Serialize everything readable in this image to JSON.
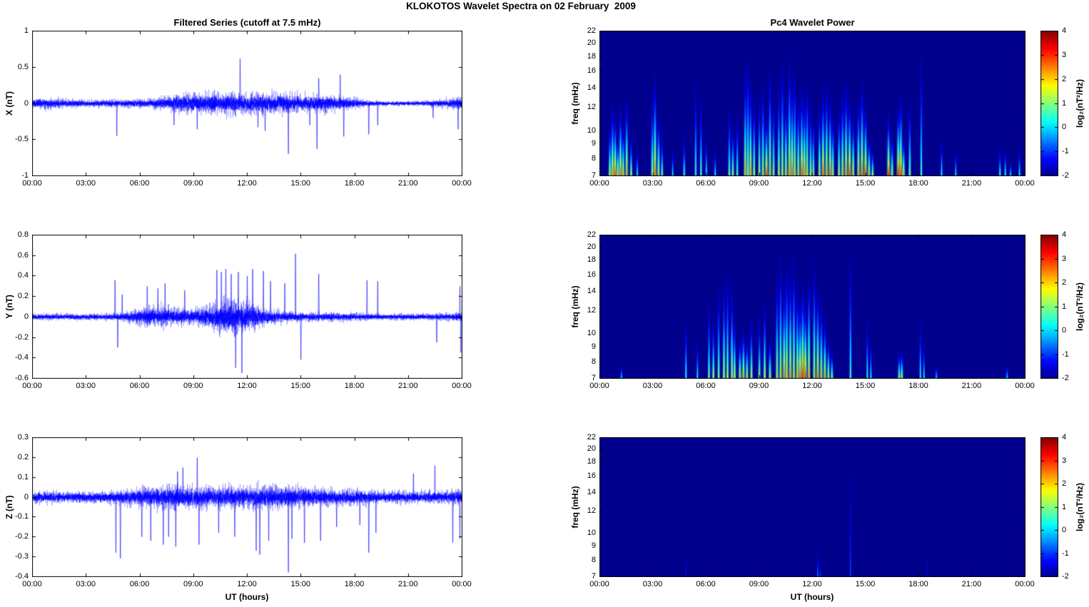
{
  "figure": {
    "title": "KLOKOTOS Wavelet Spectra on 02 February  2009"
  },
  "colors": {
    "background": "#FFFFFF",
    "axis": "#000000",
    "series_line": "#0000FF",
    "heatmap_background": "#00008C",
    "colormap": "jet"
  },
  "chart_data": {
    "time_axis": {
      "xlabel": "UT (hours)",
      "range_hours": [
        0,
        24
      ],
      "tick_hours": [
        0,
        3,
        6,
        9,
        12,
        15,
        18,
        21,
        24
      ],
      "tick_labels": [
        "00:00",
        "03:00",
        "06:00",
        "09:00",
        "12:00",
        "15:00",
        "18:00",
        "21:00",
        "00:00"
      ]
    },
    "colorbar": {
      "label": "log₂(nT²/Hz)",
      "colormap": "jet",
      "clim": [
        -2,
        4
      ],
      "tick_values": [
        4,
        3,
        2,
        1,
        0,
        -1,
        -2
      ],
      "tick_labels": [
        "4",
        "3",
        "2",
        "1",
        "0",
        "-1",
        "-2"
      ]
    },
    "panels": [
      {
        "id": "x-filtered-series",
        "type": "line",
        "title": "Filtered Series (cutoff at 7.5 mHz)",
        "ylabel": "X (nT)",
        "ylim": [
          -1,
          1
        ],
        "ytick_values": [
          1,
          0.5,
          0,
          -0.5,
          -1
        ],
        "ytick_labels": [
          "1",
          "0.5",
          "0",
          "-0.5",
          "-1"
        ],
        "seed": 11,
        "noise_envelope_hourly": [
          0.11,
          0.12,
          0.09,
          0.08,
          0.08,
          0.09,
          0.1,
          0.13,
          0.19,
          0.23,
          0.24,
          0.25,
          0.24,
          0.23,
          0.24,
          0.22,
          0.19,
          0.18,
          0.12,
          0.06,
          0.05,
          0.05,
          0.06,
          0.1,
          0.13
        ],
        "spikes_time_value": [
          [
            4.7,
            -0.45
          ],
          [
            7.9,
            -0.3
          ],
          [
            9.2,
            -0.36
          ],
          [
            11.6,
            0.62
          ],
          [
            12.6,
            -0.33
          ],
          [
            13.0,
            -0.38
          ],
          [
            14.3,
            -0.7
          ],
          [
            15.5,
            -0.3
          ],
          [
            15.9,
            -0.63
          ],
          [
            16.0,
            0.35
          ],
          [
            17.2,
            0.4
          ],
          [
            17.4,
            -0.46
          ],
          [
            18.8,
            -0.43
          ],
          [
            19.3,
            -0.3
          ],
          [
            22.4,
            -0.2
          ],
          [
            23.8,
            -0.36
          ]
        ]
      },
      {
        "id": "x-wavelet-power",
        "type": "heatmap",
        "title": "Pc4 Wavelet Power",
        "ylabel": "freq (mHz)",
        "yscale": "log",
        "flim_mHz": [
          7,
          22
        ],
        "ytick_values": [
          22,
          20,
          18,
          16,
          14,
          12,
          10,
          9,
          8,
          7
        ],
        "ytick_labels": [
          "22",
          "20",
          "18",
          "16",
          "14",
          "12",
          "10",
          "9",
          "8",
          "7"
        ],
        "clim_log2_power": [
          -2,
          4
        ],
        "event_format": [
          "hour",
          "freq_top_mHz",
          "peak_log2_power_at_base"
        ],
        "events": [
          [
            0.55,
            11,
            2.0
          ],
          [
            0.7,
            13,
            2.6
          ],
          [
            0.85,
            12,
            3.0
          ],
          [
            1.0,
            10,
            2.2
          ],
          [
            1.15,
            13,
            2.8
          ],
          [
            1.3,
            11,
            2.2
          ],
          [
            1.5,
            14,
            2.5
          ],
          [
            1.75,
            10,
            1.6
          ],
          [
            2.1,
            9,
            0.6
          ],
          [
            2.95,
            14,
            1.8
          ],
          [
            3.1,
            17,
            2.7
          ],
          [
            3.3,
            12,
            2.1
          ],
          [
            3.5,
            10,
            1.3
          ],
          [
            4.1,
            9,
            0.4
          ],
          [
            4.75,
            10,
            0.9
          ],
          [
            5.4,
            16,
            0.9
          ],
          [
            5.7,
            14,
            1.0
          ],
          [
            6.0,
            10,
            0.6
          ],
          [
            6.5,
            9,
            0.5
          ],
          [
            7.3,
            13,
            1.3
          ],
          [
            7.5,
            11,
            1.6
          ],
          [
            7.75,
            12,
            1.1
          ],
          [
            8.2,
            18,
            2.2
          ],
          [
            8.35,
            20,
            1.8
          ],
          [
            8.5,
            16,
            2.4
          ],
          [
            8.7,
            14,
            1.7
          ],
          [
            9.0,
            14,
            1.8
          ],
          [
            9.2,
            16,
            2.0
          ],
          [
            9.4,
            12,
            3.0
          ],
          [
            9.6,
            18,
            2.2
          ],
          [
            9.8,
            14,
            1.6
          ],
          [
            10.1,
            16,
            1.8
          ],
          [
            10.3,
            19,
            2.0
          ],
          [
            10.5,
            14,
            2.2
          ],
          [
            10.7,
            20,
            2.4
          ],
          [
            10.85,
            16,
            2.8
          ],
          [
            11.0,
            18,
            2.0
          ],
          [
            11.2,
            14,
            2.2
          ],
          [
            11.4,
            15,
            3.0
          ],
          [
            11.55,
            14,
            2.6
          ],
          [
            11.7,
            16,
            2.0
          ],
          [
            11.9,
            13,
            1.8
          ],
          [
            12.05,
            12,
            1.5
          ],
          [
            12.4,
            13,
            2.0
          ],
          [
            12.6,
            15,
            2.8
          ],
          [
            12.8,
            16,
            2.4
          ],
          [
            13.0,
            14,
            2.8
          ],
          [
            13.15,
            12,
            2.0
          ],
          [
            13.5,
            13,
            1.8
          ],
          [
            13.7,
            15,
            2.2
          ],
          [
            13.9,
            16,
            2.6
          ],
          [
            14.1,
            14,
            3.0
          ],
          [
            14.3,
            12,
            2.2
          ],
          [
            14.6,
            14,
            2.4
          ],
          [
            14.8,
            16,
            2.8
          ],
          [
            15.0,
            13,
            3.0
          ],
          [
            15.2,
            10,
            2.2
          ],
          [
            15.4,
            9,
            1.6
          ],
          [
            16.3,
            12,
            3.2
          ],
          [
            16.5,
            10,
            2.0
          ],
          [
            16.85,
            13,
            3.4
          ],
          [
            17.0,
            14,
            3.2
          ],
          [
            17.15,
            10,
            2.2
          ],
          [
            17.5,
            14,
            1.4
          ],
          [
            18.15,
            21,
            0.9
          ],
          [
            19.3,
            10,
            0.5
          ],
          [
            20.1,
            9,
            0.4
          ],
          [
            22.6,
            9,
            0.8
          ],
          [
            22.9,
            9,
            0.7
          ],
          [
            23.2,
            8,
            0.5
          ],
          [
            23.7,
            9,
            0.6
          ]
        ]
      },
      {
        "id": "y-filtered-series",
        "type": "line",
        "title": "Filtered Series (cutoff at 7.5 mHz)",
        "ylabel": "Y (nT)",
        "ylim": [
          -0.6,
          0.8
        ],
        "ytick_values": [
          0.8,
          0.6,
          0.4,
          0.2,
          0,
          -0.2,
          -0.4,
          -0.6
        ],
        "ytick_labels": [
          "0.8",
          "0.6",
          "0.4",
          "0.2",
          "0",
          "-0.2",
          "-0.4",
          "-0.6"
        ],
        "seed": 23,
        "noise_envelope_hourly": [
          0.05,
          0.055,
          0.05,
          0.05,
          0.05,
          0.06,
          0.13,
          0.17,
          0.15,
          0.12,
          0.2,
          0.28,
          0.24,
          0.13,
          0.09,
          0.07,
          0.07,
          0.07,
          0.06,
          0.05,
          0.05,
          0.05,
          0.05,
          0.06,
          0.07
        ],
        "spikes_time_value": [
          [
            4.6,
            0.36
          ],
          [
            4.75,
            -0.3
          ],
          [
            5.0,
            0.22
          ],
          [
            6.4,
            0.3
          ],
          [
            7.0,
            0.28
          ],
          [
            7.4,
            0.33
          ],
          [
            8.5,
            0.26
          ],
          [
            10.3,
            0.46
          ],
          [
            10.55,
            0.44
          ],
          [
            10.8,
            0.47
          ],
          [
            11.1,
            0.42
          ],
          [
            11.35,
            -0.5
          ],
          [
            11.5,
            0.44
          ],
          [
            11.7,
            -0.55
          ],
          [
            12.0,
            0.4
          ],
          [
            12.3,
            0.47
          ],
          [
            12.9,
            0.45
          ],
          [
            13.3,
            0.35
          ],
          [
            14.1,
            0.33
          ],
          [
            14.7,
            0.62
          ],
          [
            15.0,
            -0.42
          ],
          [
            16.0,
            0.42
          ],
          [
            18.7,
            0.36
          ],
          [
            19.3,
            0.35
          ],
          [
            22.6,
            -0.25
          ],
          [
            23.9,
            0.3
          ],
          [
            23.95,
            -0.35
          ]
        ]
      },
      {
        "id": "y-wavelet-power",
        "type": "heatmap",
        "title": "Pc4 Wavelet Power",
        "ylabel": "freq (mHz)",
        "yscale": "log",
        "flim_mHz": [
          7,
          22
        ],
        "ytick_values": [
          22,
          20,
          18,
          16,
          14,
          12,
          10,
          9,
          8,
          7
        ],
        "ytick_labels": [
          "22",
          "20",
          "18",
          "16",
          "14",
          "12",
          "10",
          "9",
          "8",
          "7"
        ],
        "clim_log2_power": [
          -2,
          4
        ],
        "event_format": [
          "hour",
          "freq_top_mHz",
          "peak_log2_power_at_base"
        ],
        "events": [
          [
            1.2,
            8,
            0.3
          ],
          [
            4.85,
            12,
            0.7
          ],
          [
            5.5,
            10,
            0.5
          ],
          [
            6.15,
            14,
            1.2
          ],
          [
            6.4,
            12,
            1.6
          ],
          [
            6.7,
            16,
            1.4
          ],
          [
            7.0,
            17,
            1.8
          ],
          [
            7.2,
            18,
            1.6
          ],
          [
            7.45,
            16,
            2.0
          ],
          [
            7.6,
            12,
            1.8
          ],
          [
            7.9,
            10,
            2.2
          ],
          [
            8.1,
            11,
            2.4
          ],
          [
            8.3,
            10,
            2.0
          ],
          [
            8.55,
            12,
            1.7
          ],
          [
            9.0,
            12,
            1.5
          ],
          [
            9.3,
            14,
            1.7
          ],
          [
            9.6,
            10,
            1.9
          ],
          [
            10.0,
            18,
            1.8
          ],
          [
            10.2,
            21,
            2.0
          ],
          [
            10.4,
            16,
            2.8
          ],
          [
            10.55,
            20,
            2.2
          ],
          [
            10.75,
            18,
            2.6
          ],
          [
            10.95,
            21,
            2.0
          ],
          [
            11.15,
            16,
            2.4
          ],
          [
            11.3,
            14,
            3.0
          ],
          [
            11.45,
            16,
            3.4
          ],
          [
            11.6,
            14,
            3.1
          ],
          [
            11.8,
            18,
            2.4
          ],
          [
            12.1,
            20,
            2.0
          ],
          [
            12.3,
            16,
            2.6
          ],
          [
            12.5,
            14,
            2.2
          ],
          [
            12.7,
            12,
            2.4
          ],
          [
            12.9,
            10,
            2.0
          ],
          [
            13.1,
            9,
            1.6
          ],
          [
            14.15,
            22,
            0.9
          ],
          [
            15.1,
            12,
            0.7
          ],
          [
            15.3,
            10,
            0.5
          ],
          [
            16.9,
            9,
            1.6
          ],
          [
            17.05,
            9,
            1.9
          ],
          [
            18.1,
            12,
            0.6
          ],
          [
            18.3,
            10,
            0.4
          ],
          [
            19.0,
            8,
            0.3
          ],
          [
            23.0,
            8,
            0.3
          ]
        ]
      },
      {
        "id": "z-filtered-series",
        "type": "line",
        "title": "Filtered Series (cutoff at 7.5 mHz)",
        "ylabel": "Z (nT)",
        "ylim": [
          -0.4,
          0.3
        ],
        "ytick_values": [
          0.3,
          0.2,
          0.1,
          0,
          -0.1,
          -0.2,
          -0.3,
          -0.4
        ],
        "ytick_labels": [
          "0.3",
          "0.2",
          "0.1",
          "0",
          "-0.1",
          "-0.2",
          "-0.3",
          "-0.4"
        ],
        "seed": 37,
        "noise_envelope_hourly": [
          0.045,
          0.05,
          0.045,
          0.045,
          0.05,
          0.06,
          0.075,
          0.09,
          0.1,
          0.095,
          0.09,
          0.095,
          0.095,
          0.09,
          0.09,
          0.085,
          0.075,
          0.07,
          0.065,
          0.055,
          0.05,
          0.05,
          0.05,
          0.055,
          0.06
        ],
        "spikes_time_value": [
          [
            4.65,
            -0.28
          ],
          [
            4.9,
            -0.31
          ],
          [
            6.1,
            -0.2
          ],
          [
            6.6,
            -0.22
          ],
          [
            7.3,
            -0.24
          ],
          [
            7.6,
            -0.2
          ],
          [
            8.0,
            -0.25
          ],
          [
            8.1,
            0.13
          ],
          [
            8.4,
            0.15
          ],
          [
            9.2,
            0.2
          ],
          [
            9.3,
            -0.24
          ],
          [
            10.4,
            -0.18
          ],
          [
            11.3,
            -0.2
          ],
          [
            12.5,
            -0.27
          ],
          [
            12.7,
            -0.29
          ],
          [
            13.2,
            -0.22
          ],
          [
            14.3,
            -0.38
          ],
          [
            14.5,
            -0.21
          ],
          [
            15.2,
            -0.23
          ],
          [
            16.1,
            -0.22
          ],
          [
            17.0,
            -0.15
          ],
          [
            18.3,
            -0.14
          ],
          [
            18.8,
            -0.28
          ],
          [
            19.2,
            -0.18
          ],
          [
            21.3,
            0.12
          ],
          [
            22.5,
            0.16
          ],
          [
            23.5,
            -0.23
          ],
          [
            23.9,
            -0.21
          ]
        ]
      },
      {
        "id": "z-wavelet-power",
        "type": "heatmap",
        "title": "Pc4 Wavelet Power",
        "ylabel": "freq (mHz)",
        "yscale": "log",
        "flim_mHz": [
          7,
          22
        ],
        "ytick_values": [
          22,
          20,
          18,
          16,
          14,
          12,
          10,
          9,
          8,
          7
        ],
        "ytick_labels": [
          "22",
          "20",
          "18",
          "16",
          "14",
          "12",
          "10",
          "9",
          "8",
          "7"
        ],
        "clim_log2_power": [
          -2,
          4
        ],
        "event_format": [
          "hour",
          "freq_top_mHz",
          "peak_log2_power_at_base"
        ],
        "events": [
          [
            4.85,
            9,
            -1.2
          ],
          [
            12.3,
            9,
            -0.4
          ],
          [
            12.45,
            8,
            -0.7
          ],
          [
            14.15,
            22,
            -0.8
          ],
          [
            18.5,
            9,
            -1.4
          ]
        ]
      }
    ]
  }
}
